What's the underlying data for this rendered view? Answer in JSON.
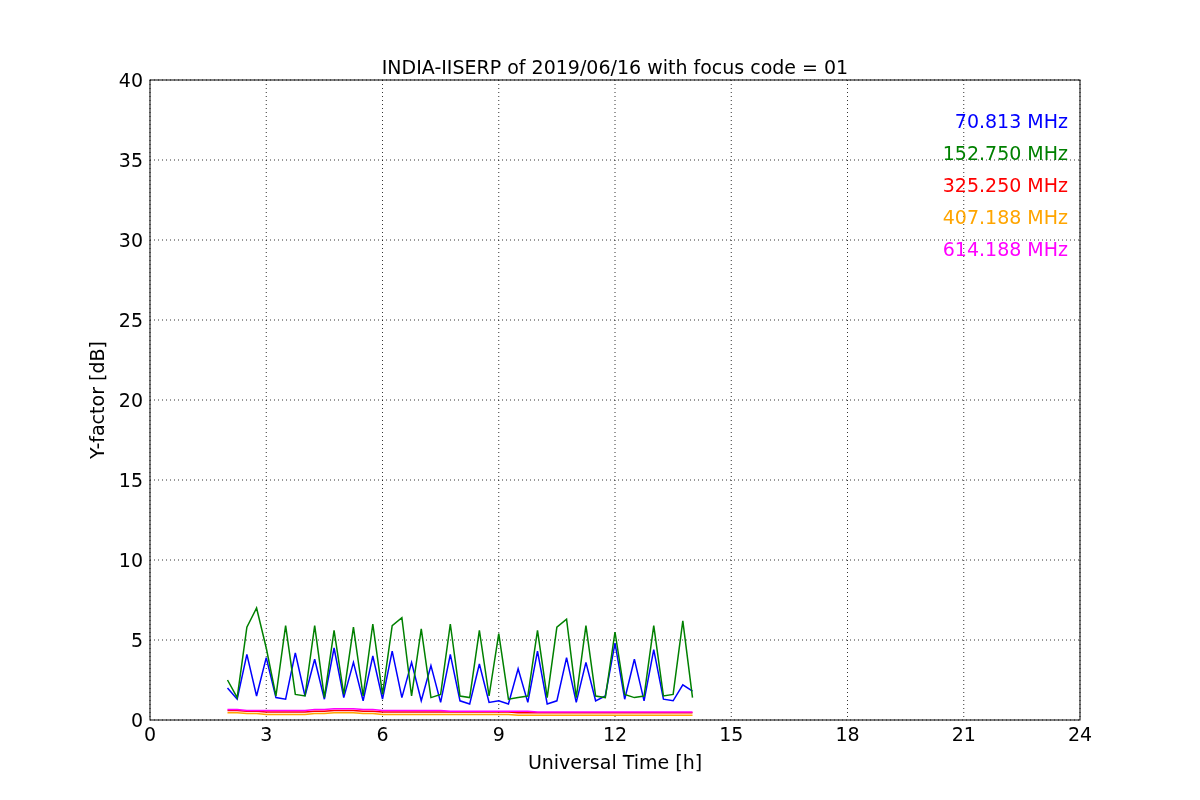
{
  "chart_data": {
    "type": "line",
    "grid": true,
    "title": "INDIA-IISERP of 2019/06/16 with focus code = 01",
    "xlabel": "Universal Time [h]",
    "ylabel": "Y-factor [dB]",
    "xlim": [
      0,
      24
    ],
    "ylim": [
      0,
      40
    ],
    "xticks": [
      0,
      3,
      6,
      9,
      12,
      15,
      18,
      21,
      24
    ],
    "yticks": [
      0,
      5,
      10,
      15,
      20,
      25,
      30,
      35,
      40
    ],
    "x": [
      2,
      2.25,
      2.5,
      2.75,
      3,
      3.25,
      3.5,
      3.75,
      4,
      4.25,
      4.5,
      4.75,
      5,
      5.25,
      5.5,
      5.75,
      6,
      6.25,
      6.5,
      6.75,
      7,
      7.25,
      7.5,
      7.75,
      8,
      8.25,
      8.5,
      8.75,
      9,
      9.25,
      9.5,
      9.75,
      10,
      10.25,
      10.5,
      10.75,
      11,
      11.25,
      11.5,
      11.75,
      12,
      12.25,
      12.5,
      12.75,
      13,
      13.25,
      13.5,
      13.75,
      14
    ],
    "series": [
      {
        "name": "70.813 MHz",
        "color": "#0000ff",
        "values": [
          2.0,
          1.3,
          4.1,
          1.5,
          3.9,
          1.4,
          1.3,
          4.2,
          1.5,
          3.8,
          1.3,
          4.5,
          1.4,
          3.6,
          1.2,
          4.0,
          1.3,
          4.3,
          1.4,
          3.6,
          1.2,
          3.4,
          1.1,
          4.1,
          1.2,
          1.0,
          3.5,
          1.1,
          1.2,
          1.0,
          3.2,
          1.1,
          4.3,
          1.0,
          1.2,
          3.9,
          1.1,
          3.6,
          1.2,
          1.5,
          4.8,
          1.3,
          3.8,
          1.2,
          4.4,
          1.3,
          1.2,
          2.2,
          1.8
        ]
      },
      {
        "name": "152.750 MHz",
        "color": "#008000",
        "values": [
          2.5,
          1.4,
          5.8,
          7.0,
          4.5,
          1.5,
          5.9,
          1.6,
          1.5,
          5.9,
          1.4,
          5.6,
          1.6,
          5.8,
          1.5,
          6.0,
          1.6,
          5.9,
          6.4,
          1.5,
          5.7,
          1.4,
          1.6,
          6.0,
          1.5,
          1.4,
          5.6,
          1.5,
          5.4,
          1.3,
          1.4,
          1.5,
          5.6,
          1.4,
          5.8,
          6.3,
          1.4,
          5.9,
          1.5,
          1.4,
          5.5,
          1.6,
          1.4,
          1.5,
          5.9,
          1.5,
          1.6,
          6.2,
          1.4
        ]
      },
      {
        "name": "325.250 MHz",
        "color": "#ff0000",
        "values": [
          0.6,
          0.6,
          0.55,
          0.55,
          0.5,
          0.5,
          0.5,
          0.5,
          0.5,
          0.55,
          0.55,
          0.6,
          0.6,
          0.6,
          0.55,
          0.55,
          0.5,
          0.5,
          0.5,
          0.5,
          0.5,
          0.5,
          0.5,
          0.5,
          0.5,
          0.5,
          0.5,
          0.5,
          0.5,
          0.5,
          0.45,
          0.45,
          0.45,
          0.45,
          0.45,
          0.45,
          0.45,
          0.45,
          0.45,
          0.45,
          0.45,
          0.45,
          0.45,
          0.45,
          0.45,
          0.45,
          0.45,
          0.45,
          0.45
        ]
      },
      {
        "name": "407.188 MHz",
        "color": "#ffa500",
        "values": [
          0.45,
          0.45,
          0.4,
          0.4,
          0.35,
          0.35,
          0.35,
          0.35,
          0.35,
          0.4,
          0.4,
          0.45,
          0.45,
          0.45,
          0.4,
          0.4,
          0.35,
          0.35,
          0.35,
          0.35,
          0.35,
          0.35,
          0.35,
          0.35,
          0.35,
          0.35,
          0.35,
          0.35,
          0.35,
          0.35,
          0.3,
          0.3,
          0.3,
          0.3,
          0.3,
          0.3,
          0.3,
          0.3,
          0.3,
          0.3,
          0.3,
          0.3,
          0.3,
          0.3,
          0.3,
          0.3,
          0.3,
          0.3,
          0.3
        ]
      },
      {
        "name": "614.188 MHz",
        "color": "#ff00ff",
        "values": [
          0.65,
          0.65,
          0.6,
          0.6,
          0.6,
          0.6,
          0.6,
          0.6,
          0.6,
          0.65,
          0.65,
          0.7,
          0.7,
          0.7,
          0.65,
          0.65,
          0.6,
          0.6,
          0.6,
          0.6,
          0.6,
          0.6,
          0.6,
          0.55,
          0.55,
          0.55,
          0.55,
          0.55,
          0.55,
          0.55,
          0.55,
          0.55,
          0.5,
          0.5,
          0.5,
          0.5,
          0.5,
          0.5,
          0.5,
          0.5,
          0.5,
          0.5,
          0.5,
          0.5,
          0.5,
          0.5,
          0.5,
          0.5,
          0.5
        ]
      }
    ]
  }
}
